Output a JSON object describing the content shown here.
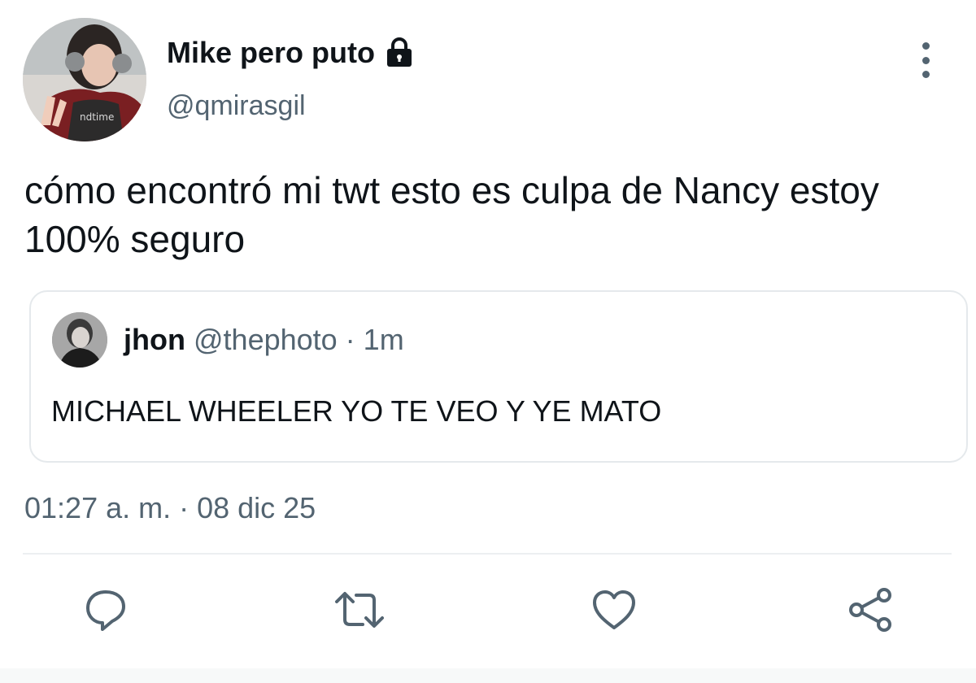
{
  "author": {
    "display_name": "Mike pero puto",
    "handle": "@qmirasgil",
    "protected_icon": "lock-icon"
  },
  "tweet": {
    "text": "cómo encontró mi twt esto es culpa de Nancy estoy 100% seguro",
    "timestamp": "01:27 a. m. · 08 dic 25"
  },
  "quoted_tweet": {
    "display_name": "jhon",
    "meta": "@thephoto · 1m",
    "text": "MICHAEL WHEELER YO TE VEO Y YE MATO"
  },
  "actions": {
    "reply_icon": "reply-icon",
    "retweet_icon": "retweet-icon",
    "like_icon": "heart-icon",
    "share_icon": "share-icon"
  },
  "menu_icon": "more-vertical-icon",
  "colors": {
    "primary_text": "#0f1419",
    "secondary_text": "#536471",
    "border": "#e5e9ec"
  }
}
